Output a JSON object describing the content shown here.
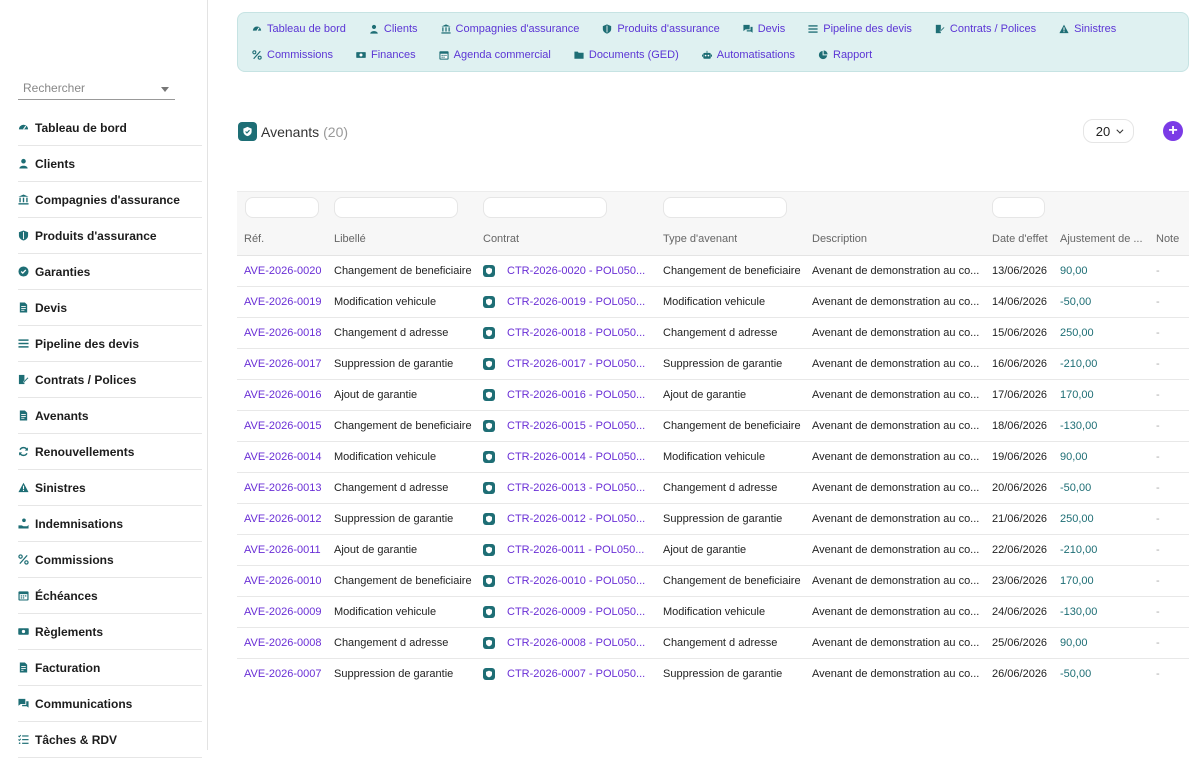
{
  "sidebar": {
    "search_placeholder": "Rechercher",
    "items": [
      {
        "label": "Tableau de bord",
        "icon": "dashboard-icon"
      },
      {
        "label": "Clients",
        "icon": "user-icon"
      },
      {
        "label": "Compagnies d'assurance",
        "icon": "bank-icon"
      },
      {
        "label": "Produits d'assurance",
        "icon": "shield-icon"
      },
      {
        "label": "Garanties",
        "icon": "check-badge-icon"
      },
      {
        "label": "Devis",
        "icon": "document-icon"
      },
      {
        "label": "Pipeline des devis",
        "icon": "list-icon"
      },
      {
        "label": "Contrats / Polices",
        "icon": "contract-edit-icon"
      },
      {
        "label": "Avenants",
        "icon": "document-icon"
      },
      {
        "label": "Renouvellements",
        "icon": "refresh-icon"
      },
      {
        "label": "Sinistres",
        "icon": "warning-icon"
      },
      {
        "label": "Indemnisations",
        "icon": "hand-coin-icon"
      },
      {
        "label": "Commissions",
        "icon": "percent-icon"
      },
      {
        "label": "Échéances",
        "icon": "calendar-icon"
      },
      {
        "label": "Règlements",
        "icon": "money-icon"
      },
      {
        "label": "Facturation",
        "icon": "invoice-icon"
      },
      {
        "label": "Communications",
        "icon": "chat-icon"
      },
      {
        "label": "Tâches & RDV",
        "icon": "tasks-icon"
      }
    ]
  },
  "topnav": {
    "row1": [
      {
        "label": "Tableau de bord",
        "icon": "dashboard-icon"
      },
      {
        "label": "Clients",
        "icon": "user-icon"
      },
      {
        "label": "Compagnies d'assurance",
        "icon": "bank-icon"
      },
      {
        "label": "Produits d'assurance",
        "icon": "shield-icon"
      },
      {
        "label": "Devis",
        "icon": "chat-icon"
      },
      {
        "label": "Pipeline des devis",
        "icon": "list-icon"
      },
      {
        "label": "Contrats / Polices",
        "icon": "contract-edit-icon"
      },
      {
        "label": "Sinistres",
        "icon": "warning-icon"
      }
    ],
    "row2": [
      {
        "label": "Commissions",
        "icon": "percent-icon"
      },
      {
        "label": "Finances",
        "icon": "money-icon"
      },
      {
        "label": "Agenda commercial",
        "icon": "calendar-icon"
      },
      {
        "label": "Documents (GED)",
        "icon": "folder-icon"
      },
      {
        "label": "Automatisations",
        "icon": "robot-icon"
      },
      {
        "label": "Rapport",
        "icon": "pie-chart-icon"
      }
    ]
  },
  "page": {
    "title": "Avenants",
    "count": "(20)",
    "page_size": "20",
    "add_label": "+"
  },
  "table": {
    "headers": {
      "ref": "Réf.",
      "libelle": "Libellé",
      "contrat": "Contrat",
      "type": "Type d'avenant",
      "description": "Description",
      "date": "Date d'effet",
      "ajustement": "Ajustement de ...",
      "note": "Note"
    },
    "rows": [
      {
        "ref": "AVE-2026-0020",
        "libelle": "Changement de beneficiaire",
        "contrat": "CTR-2026-0020 - POL050...",
        "type": "Changement de beneficiaire",
        "description": "Avenant de demonstration au co...",
        "date": "13/06/2026",
        "ajustement": "90,00",
        "note": "-"
      },
      {
        "ref": "AVE-2026-0019",
        "libelle": "Modification vehicule",
        "contrat": "CTR-2026-0019 - POL050...",
        "type": "Modification vehicule",
        "description": "Avenant de demonstration au co...",
        "date": "14/06/2026",
        "ajustement": "-50,00",
        "note": "-"
      },
      {
        "ref": "AVE-2026-0018",
        "libelle": "Changement d adresse",
        "contrat": "CTR-2026-0018 - POL050...",
        "type": "Changement d adresse",
        "description": "Avenant de demonstration au co...",
        "date": "15/06/2026",
        "ajustement": "250,00",
        "note": "-"
      },
      {
        "ref": "AVE-2026-0017",
        "libelle": "Suppression de garantie",
        "contrat": "CTR-2026-0017 - POL050...",
        "type": "Suppression de garantie",
        "description": "Avenant de demonstration au co...",
        "date": "16/06/2026",
        "ajustement": "-210,00",
        "note": "-"
      },
      {
        "ref": "AVE-2026-0016",
        "libelle": "Ajout de garantie",
        "contrat": "CTR-2026-0016 - POL050...",
        "type": "Ajout de garantie",
        "description": "Avenant de demonstration au co...",
        "date": "17/06/2026",
        "ajustement": "170,00",
        "note": "-"
      },
      {
        "ref": "AVE-2026-0015",
        "libelle": "Changement de beneficiaire",
        "contrat": "CTR-2026-0015 - POL050...",
        "type": "Changement de beneficiaire",
        "description": "Avenant de demonstration au co...",
        "date": "18/06/2026",
        "ajustement": "-130,00",
        "note": "-"
      },
      {
        "ref": "AVE-2026-0014",
        "libelle": "Modification vehicule",
        "contrat": "CTR-2026-0014 - POL050...",
        "type": "Modification vehicule",
        "description": "Avenant de demonstration au co...",
        "date": "19/06/2026",
        "ajustement": "90,00",
        "note": "-"
      },
      {
        "ref": "AVE-2026-0013",
        "libelle": "Changement d adresse",
        "contrat": "CTR-2026-0013 - POL050...",
        "type": "Changement d adresse",
        "description": "Avenant de demonstration au co...",
        "date": "20/06/2026",
        "ajustement": "-50,00",
        "note": "-"
      },
      {
        "ref": "AVE-2026-0012",
        "libelle": "Suppression de garantie",
        "contrat": "CTR-2026-0012 - POL050...",
        "type": "Suppression de garantie",
        "description": "Avenant de demonstration au co...",
        "date": "21/06/2026",
        "ajustement": "250,00",
        "note": "-"
      },
      {
        "ref": "AVE-2026-0011",
        "libelle": "Ajout de garantie",
        "contrat": "CTR-2026-0011 - POL050...",
        "type": "Ajout de garantie",
        "description": "Avenant de demonstration au co...",
        "date": "22/06/2026",
        "ajustement": "-210,00",
        "note": "-"
      },
      {
        "ref": "AVE-2026-0010",
        "libelle": "Changement de beneficiaire",
        "contrat": "CTR-2026-0010 - POL050...",
        "type": "Changement de beneficiaire",
        "description": "Avenant de demonstration au co...",
        "date": "23/06/2026",
        "ajustement": "170,00",
        "note": "-"
      },
      {
        "ref": "AVE-2026-0009",
        "libelle": "Modification vehicule",
        "contrat": "CTR-2026-0009 - POL050...",
        "type": "Modification vehicule",
        "description": "Avenant de demonstration au co...",
        "date": "24/06/2026",
        "ajustement": "-130,00",
        "note": "-"
      },
      {
        "ref": "AVE-2026-0008",
        "libelle": "Changement d adresse",
        "contrat": "CTR-2026-0008 - POL050...",
        "type": "Changement d adresse",
        "description": "Avenant de demonstration au co...",
        "date": "25/06/2026",
        "ajustement": "90,00",
        "note": "-"
      },
      {
        "ref": "AVE-2026-0007",
        "libelle": "Suppression de garantie",
        "contrat": "CTR-2026-0007 - POL050...",
        "type": "Suppression de garantie",
        "description": "Avenant de demonstration au co...",
        "date": "26/06/2026",
        "ajustement": "-50,00",
        "note": "-"
      }
    ]
  },
  "colors": {
    "accent": "#7b3be6",
    "link": "#6a2fd6",
    "teal": "#1e6e75",
    "nav_bg": "#dff1f1"
  }
}
